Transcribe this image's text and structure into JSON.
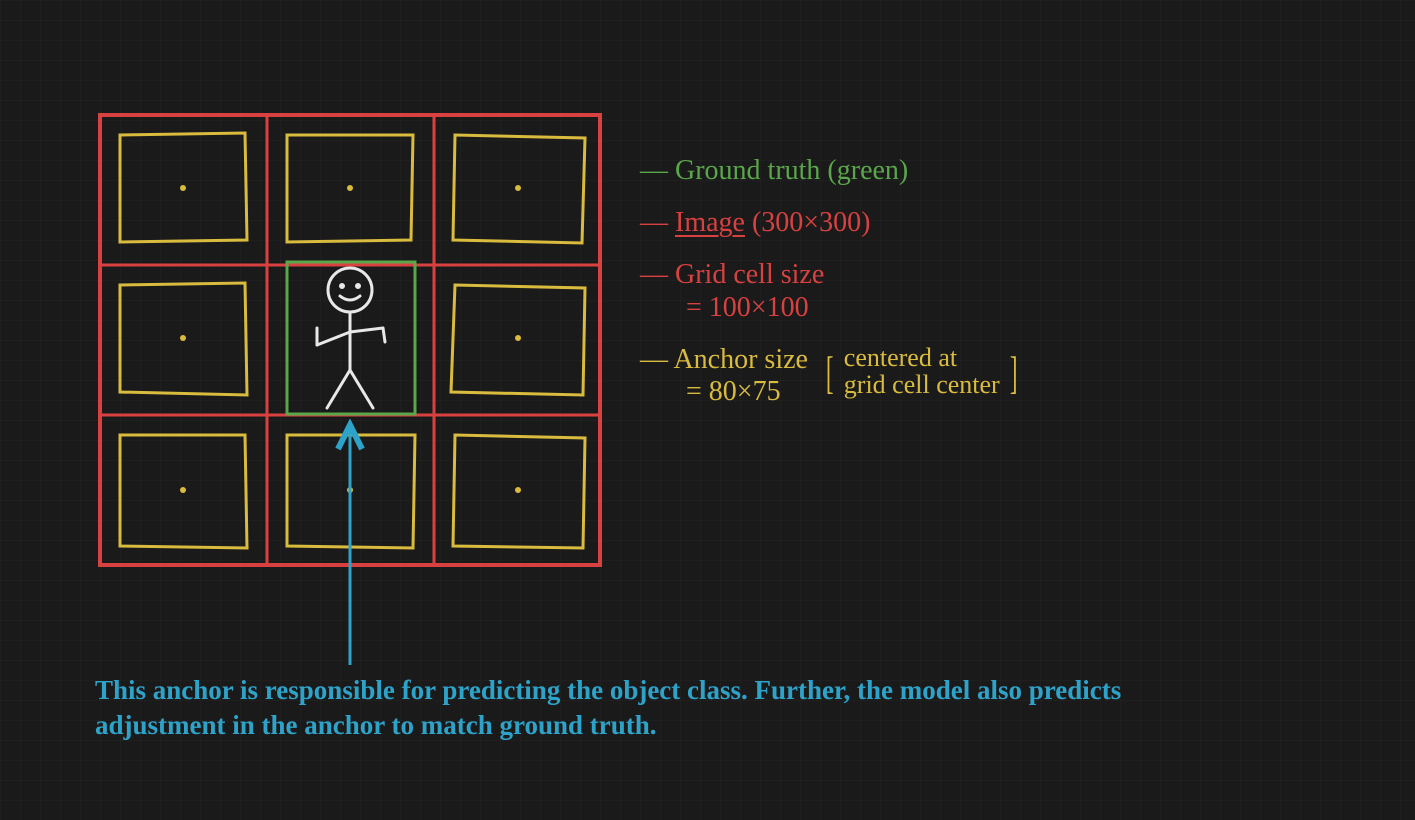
{
  "diagram": {
    "image_size": "300×300",
    "grid_cell_size": "100×100",
    "anchor_size": "80×75",
    "anchor_note_line1": "centered at",
    "anchor_note_line2": "grid cell center",
    "ground_truth_color": "green"
  },
  "legend": {
    "ground_truth": "— Ground truth (green)",
    "image_prefix": "— ",
    "image_word": "Image",
    "image_suffix": " (300×300)",
    "grid_cell_line1": "— Grid cell size",
    "grid_cell_line2": "= 100×100",
    "anchor_line1": "— Anchor size",
    "anchor_line2": "= 80×75"
  },
  "arrow_caption": "This anchor is responsible for predicting the object class. Further, the model also predicts adjustment in the anchor to match ground truth.",
  "colors": {
    "green": "#5aa64a",
    "red": "#d94141",
    "yellow": "#d9bb3e",
    "blue": "#2ea3c9",
    "white": "#e8e8e8"
  }
}
